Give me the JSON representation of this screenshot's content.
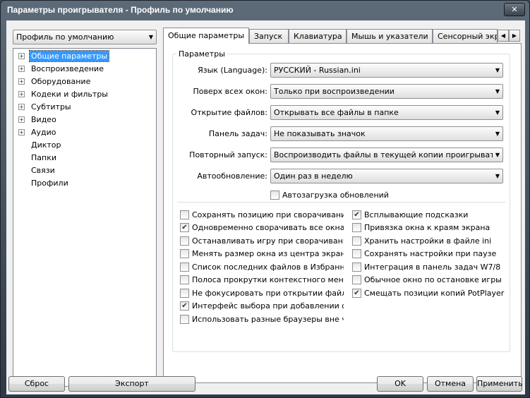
{
  "window": {
    "title": "Параметры проигрывателя - Профиль по умолчанию",
    "close_glyph": "✕"
  },
  "profile": {
    "selected": "Профиль по умолчанию"
  },
  "tree": [
    {
      "label": "Общие параметры",
      "expandable": true,
      "selected": true
    },
    {
      "label": "Воспроизведение",
      "expandable": true
    },
    {
      "label": "Оборудование",
      "expandable": true
    },
    {
      "label": "Кодеки и фильтры",
      "expandable": true
    },
    {
      "label": "Субтитры",
      "expandable": true
    },
    {
      "label": "Видео",
      "expandable": true
    },
    {
      "label": "Аудио",
      "expandable": true
    },
    {
      "label": "Диктор",
      "expandable": false
    },
    {
      "label": "Папки",
      "expandable": false
    },
    {
      "label": "Связи",
      "expandable": false
    },
    {
      "label": "Профили",
      "expandable": false
    }
  ],
  "tabs": [
    "Общие параметры",
    "Запуск",
    "Клавиатура",
    "Мышь и указатели",
    "Сенсорный экран"
  ],
  "group_title": "Параметры",
  "fields": [
    {
      "label": "Язык (Language):",
      "value": "РУССКИЙ - Russian.ini"
    },
    {
      "label": "Поверх всех окон:",
      "value": "Только при воспроизведении"
    },
    {
      "label": "Открытие файлов:",
      "value": "Открывать все файлы в папке"
    },
    {
      "label": "Панель задач:",
      "value": "Не показывать значок"
    },
    {
      "label": "Повторный запуск:",
      "value": "Воспроизводить файлы в текущей копии проигрывателя"
    },
    {
      "label": "Автообновление:",
      "value": "Один раз в неделю"
    }
  ],
  "autoload": {
    "label": "Автозагрузка обновлений",
    "checked": false
  },
  "options_left": [
    {
      "label": "Сохранять позицию при сворачивании",
      "checked": false
    },
    {
      "label": "Одновременно сворачивать все окна",
      "checked": true
    },
    {
      "label": "Останавливать игру при сворачивании",
      "checked": false
    },
    {
      "label": "Менять размер окна из центра экрана",
      "checked": false
    },
    {
      "label": "Список последних файлов в Избранном",
      "checked": false
    },
    {
      "label": "Полоса прокрутки контекстного меню",
      "checked": false
    },
    {
      "label": "Не фокусировать при открытии файла",
      "checked": false
    },
    {
      "label": "Интерфейс выбора при добавлении файлов",
      "checked": true
    },
    {
      "label": "Использовать разные браузеры вне чата",
      "checked": false
    }
  ],
  "options_right": [
    {
      "label": "Всплывающие подсказки",
      "checked": true
    },
    {
      "label": "Привязка окна к краям экрана",
      "checked": false
    },
    {
      "label": "Хранить настройки в файле ini",
      "checked": false
    },
    {
      "label": "Сохранять настройки при паузе",
      "checked": false
    },
    {
      "label": "Интеграция в панель задач W7/8",
      "checked": false
    },
    {
      "label": "Обычное окно по остановке игры",
      "checked": false
    },
    {
      "label": "Смещать позиции копий PotPlayer",
      "checked": true
    }
  ],
  "buttons": {
    "reset": "Сброс",
    "export": "Экспорт",
    "ok": "OK",
    "cancel": "Отмена",
    "apply": "Применить"
  },
  "glyphs": {
    "arrow_down": "▼",
    "arrow_left": "◀",
    "arrow_right": "▶",
    "check": "✔",
    "expand": "+"
  }
}
